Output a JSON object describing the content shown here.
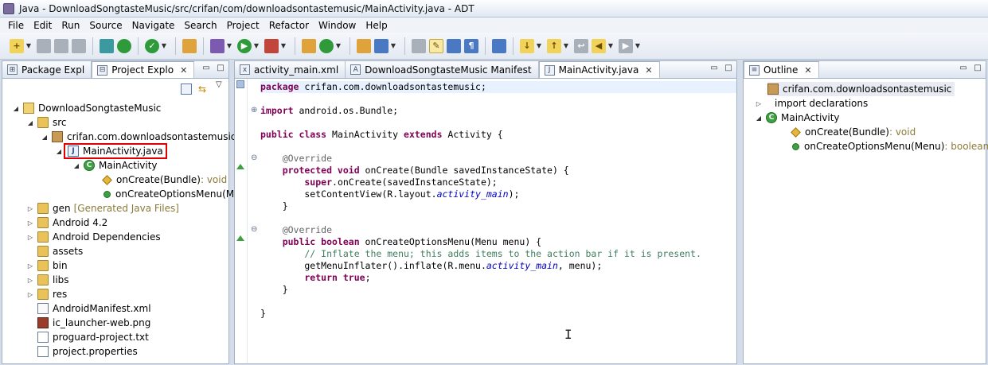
{
  "window": {
    "title": "Java - DownloadSongtasteMusic/src/crifan/com/downloadsontastemusic/MainActivity.java - ADT"
  },
  "menu": [
    "File",
    "Edit",
    "Run",
    "Source",
    "Navigate",
    "Search",
    "Project",
    "Refactor",
    "Window",
    "Help"
  ],
  "explorer": {
    "tabs": [
      {
        "label": "Package Expl",
        "close": ""
      },
      {
        "label": "Project Explo",
        "close": "✕"
      }
    ],
    "rows": [
      {
        "label": "DownloadSongtasteMusic"
      },
      {
        "label": "src"
      },
      {
        "label": "crifan.com.downloadsontastemusic"
      },
      {
        "label": "MainActivity.java"
      },
      {
        "label": "MainActivity"
      },
      {
        "label": "onCreate(Bundle)",
        "type": " : void"
      },
      {
        "label": "onCreateOptionsMenu(Me"
      },
      {
        "label": "gen",
        "extra": "[Generated Java Files]"
      },
      {
        "label": "Android 4.2"
      },
      {
        "label": "Android Dependencies"
      },
      {
        "label": "assets"
      },
      {
        "label": "bin"
      },
      {
        "label": "libs"
      },
      {
        "label": "res"
      },
      {
        "label": "AndroidManifest.xml"
      },
      {
        "label": "ic_launcher-web.png"
      },
      {
        "label": "proguard-project.txt"
      },
      {
        "label": "project.properties"
      }
    ]
  },
  "editor": {
    "tabs": [
      {
        "label": "activity_main.xml",
        "close": ""
      },
      {
        "label": "DownloadSongtasteMusic Manifest",
        "close": ""
      },
      {
        "label": "MainActivity.java",
        "close": "✕"
      }
    ],
    "code": {
      "l1_kw": "package",
      "l1_rest": " crifan.com.downloadsontastemusic;",
      "l3_kw": "import",
      "l3_rest": " android.os.Bundle;",
      "l5_kw1": "public class",
      "l5_a": " MainActivity ",
      "l5_kw2": "extends",
      "l5_b": " Activity {",
      "l7_ann": "    @Override",
      "l8_kw": "    protected void",
      "l8_rest": " onCreate(Bundle savedInstanceState) {",
      "l9_kw": "        super",
      "l9_rest": ".onCreate(savedInstanceState);",
      "l10_a": "        setContentView(R.layout.",
      "l10_it": "activity_main",
      "l10_b": ");",
      "l11": "    }",
      "l13_ann": "    @Override",
      "l14_kw": "    public boolean",
      "l14_rest": " onCreateOptionsMenu(Menu menu) {",
      "l15_cm": "        // Inflate the menu; this adds items to the action bar if it is present.",
      "l16_a": "        getMenuInflater().inflate(R.menu.",
      "l16_it": "activity_main",
      "l16_b": ", menu);",
      "l17_kw": "        return true",
      "l17_b": ";",
      "l18": "    }",
      "l20": "}"
    }
  },
  "outline": {
    "tab": "Outline",
    "close": "✕",
    "rows": [
      {
        "label": "crifan.com.downloadsontastemusic"
      },
      {
        "label": "import declarations"
      },
      {
        "label": "MainActivity"
      },
      {
        "label": "onCreate(Bundle)",
        "type": " : void"
      },
      {
        "label": "onCreateOptionsMenu(Menu)",
        "type": " : boolean"
      }
    ]
  },
  "colors": {
    "highlight_box": "#e00000",
    "keyword": "#7f0055",
    "comment": "#3f7f5f"
  }
}
